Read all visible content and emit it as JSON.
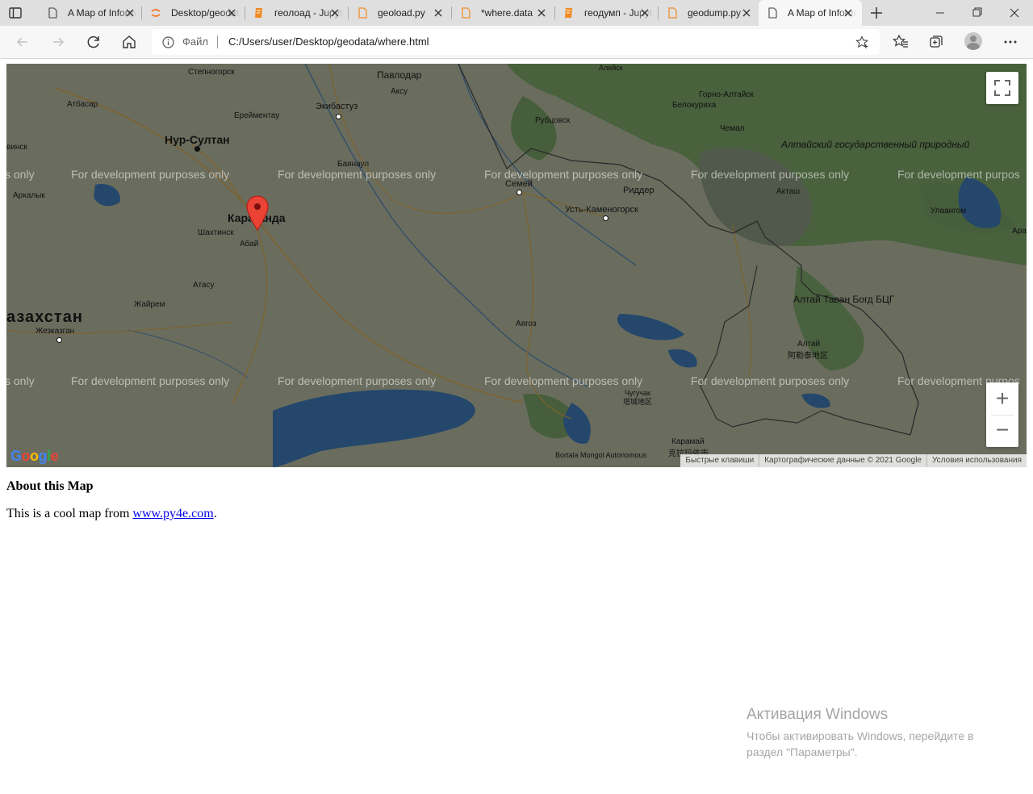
{
  "browser": {
    "tabs": [
      {
        "title": "A Map of Information",
        "icon": "page-icon",
        "active": false
      },
      {
        "title": "Desktop/geodata",
        "icon": "jupyter-icon",
        "active": false
      },
      {
        "title": "геолоад - Jupyter",
        "icon": "notebook-icon",
        "active": false
      },
      {
        "title": "geoload.py",
        "icon": "file-icon",
        "active": false
      },
      {
        "title": "*where.data",
        "icon": "file-icon",
        "active": false
      },
      {
        "title": "геодумп - Jupyter",
        "icon": "notebook-icon",
        "active": false
      },
      {
        "title": "geodump.py",
        "icon": "file-icon",
        "active": false
      },
      {
        "title": "A Map of Information",
        "icon": "page-icon",
        "active": true
      }
    ],
    "address": {
      "scheme_label": "Файл",
      "url": "C:/Users/user/Desktop/geodata/where.html"
    }
  },
  "map": {
    "watermark": "For development purposes only",
    "watermark_partial_left": "s only",
    "watermark_partial_right": "For development purpos",
    "labels": {
      "pavlodar": "Павлодар",
      "aksu": "Аксу",
      "ekibastuz": "Экибастуз",
      "stepnogorsk": "Степногорск",
      "atbasar": "Атбасар",
      "ereymentau": "Ерейментау",
      "nursultan": "Нур-Султан",
      "vinsk": "винск",
      "bayanaul": "Баянаул",
      "arkalyk": "Аркалык",
      "karaganda": "Караганда",
      "shakhtinsk": "Шахтинск",
      "abay": "Абай",
      "atasu": "Атасу",
      "zhayrem": "Жайрем",
      "kazakhstan": "азахстан",
      "zhezkazgan": "Жезказган",
      "rubtsovsk": "Рубцовск",
      "gorno_altaysk": "Горно-Алтайск",
      "belokurikha": "Белокуриха",
      "chemal": "Чемал",
      "altai_rep": "Алтайский государственный природный",
      "semey": "Семей",
      "ridder": "Риддер",
      "ust_kamenogorsk": "Усть-Каменогорск",
      "aktash": "Акташ",
      "ulaangom": "Улаангом",
      "aral": "Арал",
      "altai_tavan": "Алтай Таван Богд БЦГ",
      "ayagoz": "Аягоз",
      "altay_cn": "Алтай",
      "altay_cn_zh": "阿勒泰地区",
      "chuguchak": "Чугучак",
      "chuguchak_zh": "塔城地区",
      "bortala": "Bortala Mongol Autonomous",
      "karamay": "Карамай",
      "karamay_zh": "克拉玛依市",
      "aleysk": "Алейск"
    },
    "google_logo": "Google",
    "attribution": [
      "Быстрые клавиши",
      "Картографические данные © 2021 Google",
      "Условия использования"
    ],
    "zoom_in_label": "+",
    "zoom_out_label": "−"
  },
  "page": {
    "heading": "About this Map",
    "text_before_link": "This is a cool map from ",
    "link_text": "www.py4e.com",
    "text_after_link": "."
  },
  "windows_activation": {
    "title": "Активация Windows",
    "subtitle_line1": "Чтобы активировать Windows, перейдите в",
    "subtitle_line2": "раздел \"Параметры\"."
  },
  "colors": {
    "accent_marker": "#ea4335",
    "link": "#0000ee"
  }
}
